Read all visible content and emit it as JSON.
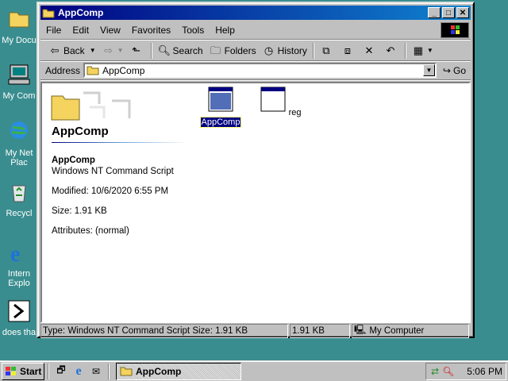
{
  "desktop": {
    "icons": [
      {
        "label": "My Docu",
        "icon": "my-documents-icon"
      },
      {
        "label": "My Com",
        "icon": "my-computer-icon"
      },
      {
        "label": "My Net",
        "label2": "Plac",
        "icon": "network-places-icon"
      },
      {
        "label": "Recycl",
        "icon": "recycle-bin-icon"
      },
      {
        "label": "Intern",
        "label2": "Explo",
        "icon": "internet-explorer-icon"
      },
      {
        "label": "does tha",
        "icon": "shortcut-icon"
      }
    ]
  },
  "window": {
    "title": "AppComp",
    "controls": {
      "minimize": "_",
      "maximize": "□",
      "close": "✕"
    },
    "menu": [
      "File",
      "Edit",
      "View",
      "Favorites",
      "Tools",
      "Help"
    ],
    "toolbar": {
      "back": "Back",
      "search": "Search",
      "folders": "Folders",
      "history": "History"
    },
    "address": {
      "label": "Address",
      "value": "AppComp",
      "go": "Go"
    },
    "left_pane": {
      "title": "AppComp",
      "file_name": "AppComp",
      "file_type": "Windows NT Command Script",
      "modified": "Modified: 10/6/2020 6:55 PM",
      "size": "Size: 1.91 KB",
      "attributes": "Attributes: (normal)"
    },
    "files": [
      {
        "label": "AppComp",
        "selected": true
      },
      {
        "label": "reg",
        "selected": false
      }
    ],
    "status": {
      "main": "Type: Windows NT Command Script Size: 1.91 KB",
      "size": "1.91 KB",
      "zone": "My Computer"
    }
  },
  "taskbar": {
    "start": "Start",
    "task": "AppComp",
    "clock": "5:06 PM"
  },
  "colors": {
    "desktop": "#3a8d8f",
    "title_start": "#000080",
    "title_end": "#1084d0",
    "selection": "#000080"
  }
}
